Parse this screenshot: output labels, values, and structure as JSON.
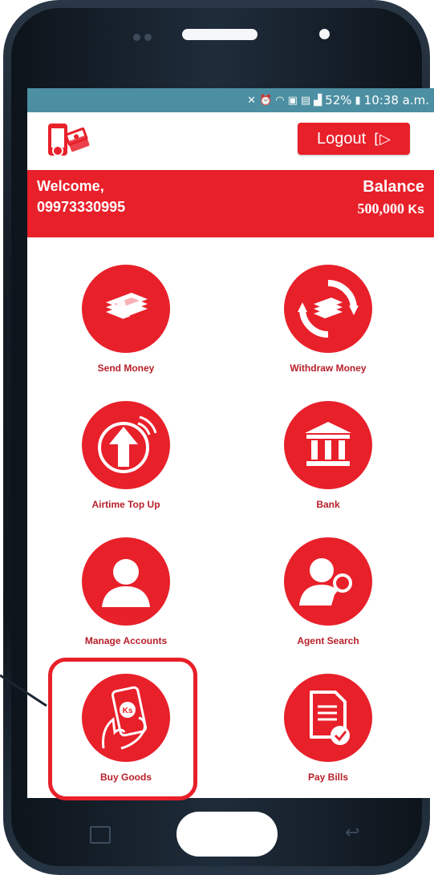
{
  "status_bar": {
    "battery": "52%",
    "time": "10:38 a.m."
  },
  "header": {
    "logout_label": "Logout"
  },
  "welcome": {
    "label": "Welcome,",
    "phone": "09973330995",
    "balance_label": "Balance",
    "balance_amount": "500,000",
    "currency": "Ks"
  },
  "menu": [
    {
      "label": "Send Money",
      "icon": "money-stack-icon"
    },
    {
      "label": "Withdraw Money",
      "icon": "money-cycle-icon"
    },
    {
      "label": "Airtime Top Up",
      "icon": "upload-arrow-signal-icon"
    },
    {
      "label": "Bank",
      "icon": "bank-building-icon"
    },
    {
      "label": "Manage Accounts",
      "icon": "user-icon"
    },
    {
      "label": "Agent Search",
      "icon": "user-search-icon"
    },
    {
      "label": "Buy Goods",
      "icon": "phone-in-hand-icon",
      "highlighted": true
    },
    {
      "label": "Pay Bills",
      "icon": "bill-check-icon"
    }
  ],
  "colors": {
    "brand_red": "#e8202a",
    "status_bar": "#4d8fa2",
    "phone_frame": "#141c25"
  }
}
